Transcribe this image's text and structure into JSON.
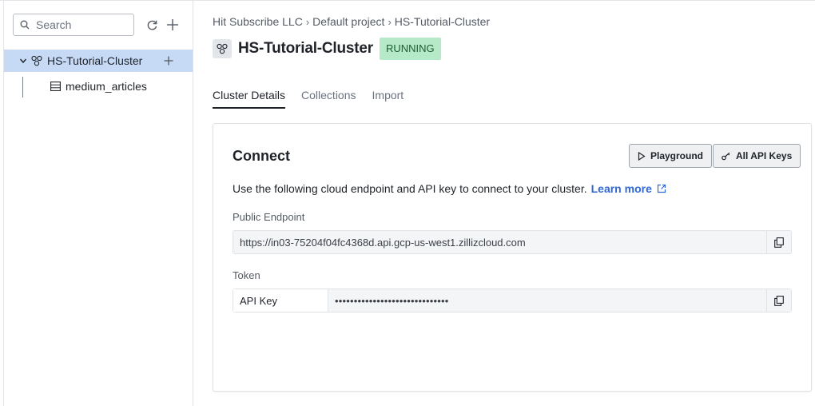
{
  "sidebar": {
    "search": {
      "placeholder": "Search",
      "value": ""
    },
    "tree": {
      "cluster": {
        "name": "HS-Tutorial-Cluster"
      },
      "collections": [
        {
          "name": "medium_articles"
        }
      ]
    }
  },
  "header": {
    "breadcrumb": [
      "Hit Subscribe LLC",
      "Default project",
      "HS-Tutorial-Cluster"
    ],
    "title": "HS-Tutorial-Cluster",
    "status": "RUNNING"
  },
  "tabs": [
    {
      "label": "Cluster Details",
      "active": true
    },
    {
      "label": "Collections",
      "active": false
    },
    {
      "label": "Import",
      "active": false
    }
  ],
  "connect": {
    "title": "Connect",
    "playground_label": "Playground",
    "api_keys_label": "All API Keys",
    "description": "Use the following cloud endpoint and API key to connect to your cluster.",
    "learn_more": "Learn more",
    "endpoint_label": "Public Endpoint",
    "endpoint_value": "https://in03-75204f04fc4368d.api.gcp-us-west1.zillizcloud.com",
    "token_label": "Token",
    "token_prefix": "API Key",
    "token_masked": "••••••••••••••••••••••••••••••"
  },
  "colors": {
    "accent": "#2f68d8",
    "selected_row": "#c6d9f5",
    "status_bg": "#b6e9c8",
    "status_text": "#1d5d33"
  },
  "icons": [
    "search-icon",
    "refresh-icon",
    "plus-icon",
    "chevron-down-icon",
    "cluster-icon",
    "table-icon",
    "play-icon",
    "key-icon",
    "external-link-icon",
    "copy-icon"
  ]
}
